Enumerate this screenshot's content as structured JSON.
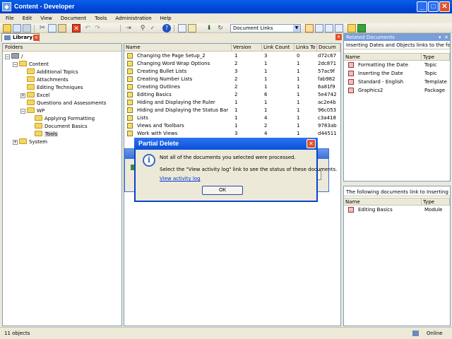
{
  "window": {
    "title": "Content - Developer",
    "min": "_",
    "max": "□",
    "close": "✕"
  },
  "menu": [
    "File",
    "Edit",
    "View",
    "Document",
    "Tools",
    "Administration",
    "Help"
  ],
  "toolbar": {
    "combo_value": "Document Links"
  },
  "library_tab": "Library",
  "folders": {
    "header": "Folders",
    "items": [
      {
        "label": "/",
        "indent": 0,
        "exp": "−"
      },
      {
        "label": "Content",
        "indent": 1,
        "exp": "−"
      },
      {
        "label": "Additional Topics",
        "indent": 2,
        "exp": ""
      },
      {
        "label": "Attachments",
        "indent": 2,
        "exp": ""
      },
      {
        "label": "Editing Techniques",
        "indent": 2,
        "exp": ""
      },
      {
        "label": "Excel",
        "indent": 2,
        "exp": "+"
      },
      {
        "label": "Questions and Assessments",
        "indent": 2,
        "exp": ""
      },
      {
        "label": "WP",
        "indent": 2,
        "exp": "−"
      },
      {
        "label": "Applying Formatting",
        "indent": 3,
        "exp": ""
      },
      {
        "label": "Document Basics",
        "indent": 3,
        "exp": ""
      },
      {
        "label": "Tools",
        "indent": 3,
        "exp": ""
      },
      {
        "label": "System",
        "indent": 1,
        "exp": "+"
      }
    ]
  },
  "list": {
    "columns": [
      "Name",
      "Version",
      "Link Count",
      "Links To",
      "Docum"
    ],
    "rows": [
      [
        "Changing the Page Setup_2",
        "1",
        "3",
        "0",
        "d72c67"
      ],
      [
        "Changing Word Wrap Options",
        "2",
        "1",
        "1",
        "2dc871"
      ],
      [
        "Creating Bullet Lists",
        "3",
        "1",
        "1",
        "57ac9f"
      ],
      [
        "Creating Number Lists",
        "2",
        "1",
        "1",
        "fab982"
      ],
      [
        "Creating Outlines",
        "2",
        "1",
        "1",
        "6a81f9"
      ],
      [
        "Editing Basics",
        "2",
        "6",
        "1",
        "5e4742"
      ],
      [
        "Hiding and Displaying the Ruler",
        "1",
        "1",
        "1",
        "ac2e4b"
      ],
      [
        "Hiding and Displaying the Status Bar",
        "1",
        "1",
        "1",
        "96c053"
      ],
      [
        "Lists",
        "1",
        "4",
        "1",
        "c3a418"
      ],
      [
        "Views and Toolbars",
        "1",
        "2",
        "1",
        "9783ab"
      ],
      [
        "Work with Views",
        "3",
        "4",
        "1",
        "d44511"
      ]
    ]
  },
  "related": {
    "title": "Related Documents",
    "subtitle": "Inserting Dates and Objects links to the follo...",
    "columns": [
      "Name",
      "Type"
    ],
    "rows": [
      [
        "Formatting the Date",
        "Topic"
      ],
      [
        "Inserting the Date",
        "Topic"
      ],
      [
        "Standard - English",
        "Template"
      ],
      [
        "Graphics2",
        "Package"
      ]
    ]
  },
  "related2": {
    "subtitle": "The following documents link to Inserting Dat...",
    "columns": [
      "Name",
      "Type"
    ],
    "rows": [
      [
        "Editing Basics",
        "Module"
      ]
    ]
  },
  "status": {
    "count": "11 objects",
    "online": "Online"
  },
  "dialog": {
    "title": "Partial Delete",
    "line1": "Not all of the documents you selected were processed.",
    "line2": "Select the \"View activity log\" link to see the status of these documents.",
    "link": "View activity log",
    "ok": "OK"
  }
}
